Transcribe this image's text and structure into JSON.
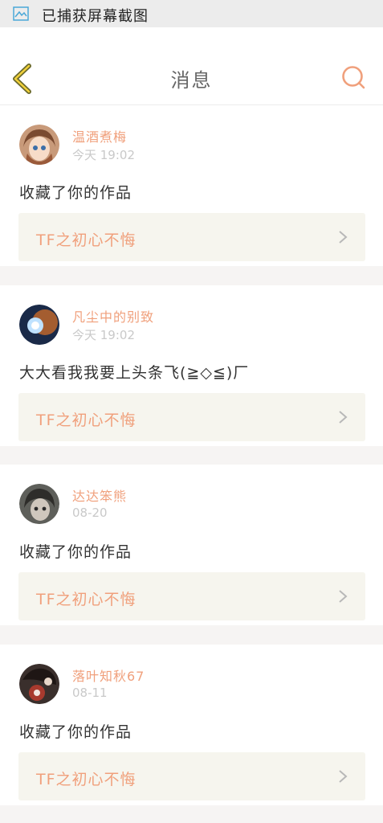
{
  "status_bar": {
    "notification": "已捕获屏幕截图",
    "icon": "screenshot-icon"
  },
  "header": {
    "title": "消息",
    "back_icon": "back-chevron-icon",
    "search_icon": "search-icon",
    "accent_color": "#f0a07c",
    "back_color": "#6b6a2c"
  },
  "messages": [
    {
      "user": "温酒煮梅",
      "time": "今天 19:02",
      "text": "收藏了你的作品",
      "work": "TF之初心不悔",
      "avatar_icon": "anime-girl-avatar"
    },
    {
      "user": "凡尘中的别致",
      "time": "今天 19:02",
      "text": "大大看我我要上头条飞(≧◇≦)厂",
      "work": "TF之初心不悔",
      "avatar_icon": "blue-light-avatar"
    },
    {
      "user": "达达笨熊",
      "time": "08-20",
      "text": "收藏了你的作品",
      "work": "TF之初心不悔",
      "avatar_icon": "doll-avatar"
    },
    {
      "user": "落叶知秋67",
      "time": "08-11",
      "text": "收藏了你的作品",
      "work": "TF之初心不悔",
      "avatar_icon": "illustration-avatar"
    }
  ]
}
